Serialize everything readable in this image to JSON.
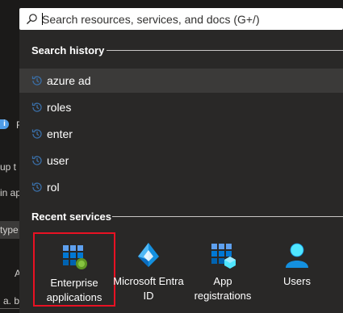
{
  "background": {
    "fragments": [
      "F",
      "up t",
      "in ap",
      "type",
      "A",
      "a.  b"
    ]
  },
  "search": {
    "placeholder": "Search resources, services, and docs (G+/)"
  },
  "history": {
    "title": "Search history",
    "items": [
      "azure ad",
      "roles",
      "enter",
      "user",
      "rol"
    ]
  },
  "recent": {
    "title": "Recent services",
    "services": [
      {
        "label_line1": "Enterprise",
        "label_line2": "applications",
        "icon": "enterprise-apps-icon"
      },
      {
        "label_line1": "Microsoft Entra",
        "label_line2": "ID",
        "icon": "entra-id-icon"
      },
      {
        "label_line1": "App",
        "label_line2": "registrations",
        "icon": "app-registrations-icon"
      },
      {
        "label_line1": "Users",
        "label_line2": "",
        "icon": "users-icon"
      }
    ]
  },
  "colors": {
    "panel": "#292827",
    "selected": "#3b3a39",
    "highlight": "#e81123",
    "accent": "#0078d4"
  }
}
